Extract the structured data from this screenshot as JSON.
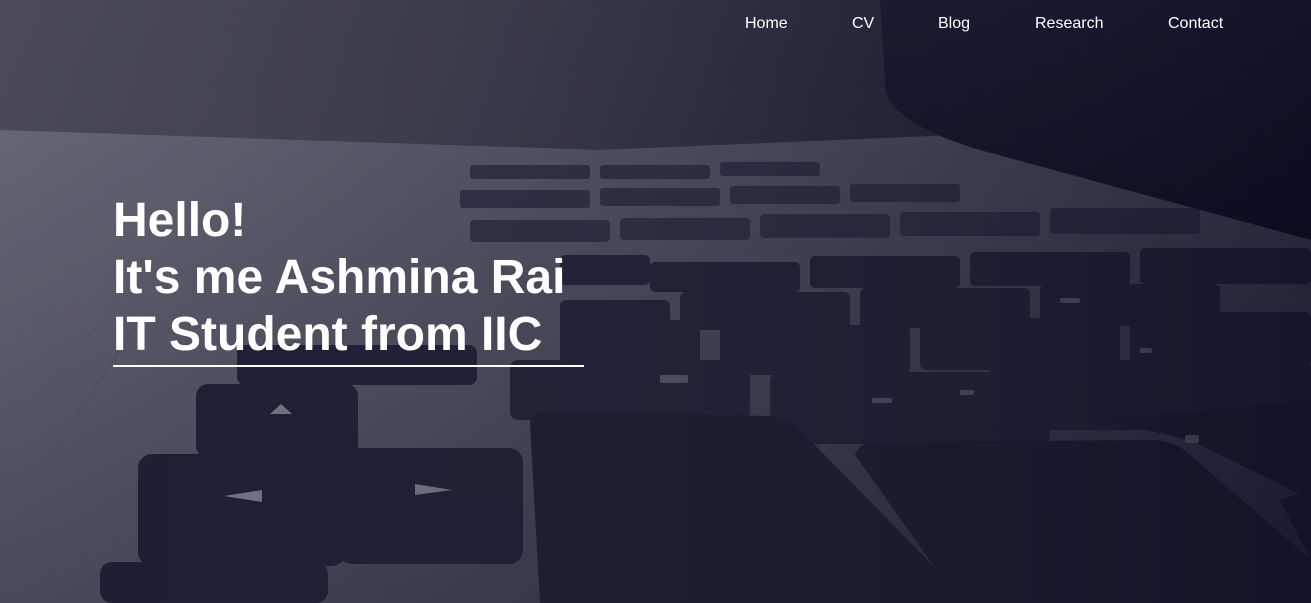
{
  "nav": {
    "items": [
      {
        "label": "Home"
      },
      {
        "label": "CV"
      },
      {
        "label": "Blog"
      },
      {
        "label": "Research"
      },
      {
        "label": "Contact"
      }
    ]
  },
  "hero": {
    "line1": "Hello!",
    "line2": "It's me Ashmina Rai",
    "line3": "IT Student from IIC",
    "background": "laptop-keyboard-photo"
  },
  "colors": {
    "text": "#ffffff",
    "key": "#20233a",
    "deck": "#6f707e"
  }
}
